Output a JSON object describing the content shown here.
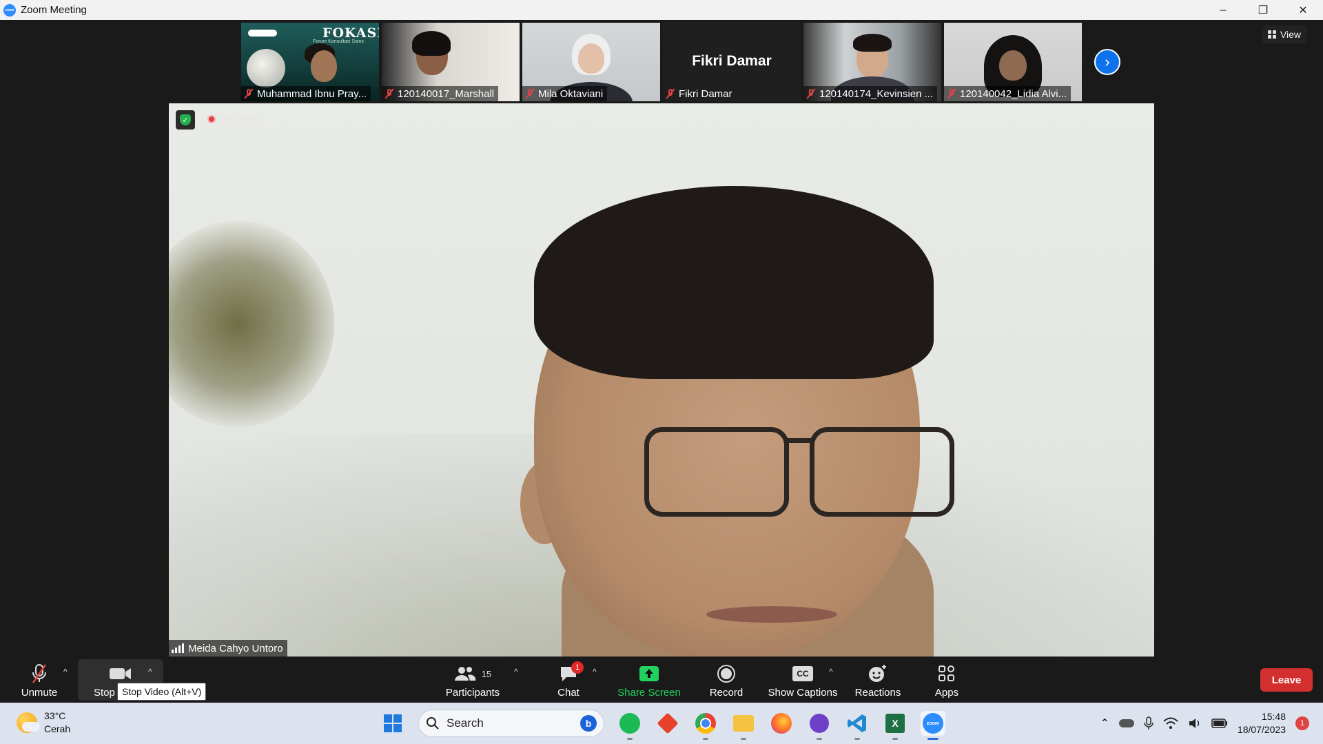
{
  "window": {
    "title": "Zoom Meeting",
    "minimize": "–",
    "restore": "❐",
    "close": "✕"
  },
  "view": {
    "label": "View"
  },
  "thumbnails": [
    {
      "name": "Muhammad Ibnu Pray...",
      "poster_title": "FOKASI",
      "poster_sub": "Forum Konsultasi Sains"
    },
    {
      "name": "120140017_Marshall"
    },
    {
      "name": "Mila Oktaviani"
    },
    {
      "name": "Fikri Damar",
      "display_name": "Fikri Damar"
    },
    {
      "name": "120140174_Kevinsien ..."
    },
    {
      "name": "120140042_Lidia Alvi..."
    }
  ],
  "main": {
    "speaker": "Meida Cahyo Untoro",
    "recording": "Recording",
    "next": "›"
  },
  "toolbar": {
    "unmute": "Unmute",
    "stop_video": "Stop",
    "tooltip": "Stop Video (Alt+V)",
    "participants": "Participants",
    "participants_count": "15",
    "chat": "Chat",
    "chat_badge": "1",
    "share": "Share Screen",
    "record": "Record",
    "captions": "Show Captions",
    "cc": "CC",
    "reactions": "Reactions",
    "apps": "Apps",
    "leave": "Leave",
    "caret": "^"
  },
  "taskbar": {
    "temp": "33°C",
    "condition": "Cerah",
    "search": "Search",
    "time": "15:48",
    "date": "18/07/2023",
    "notifications": "1"
  },
  "colors": {
    "accent": "#0e72ed",
    "leave": "#d32f2f",
    "share": "#23d160",
    "muted": "#e04343"
  }
}
